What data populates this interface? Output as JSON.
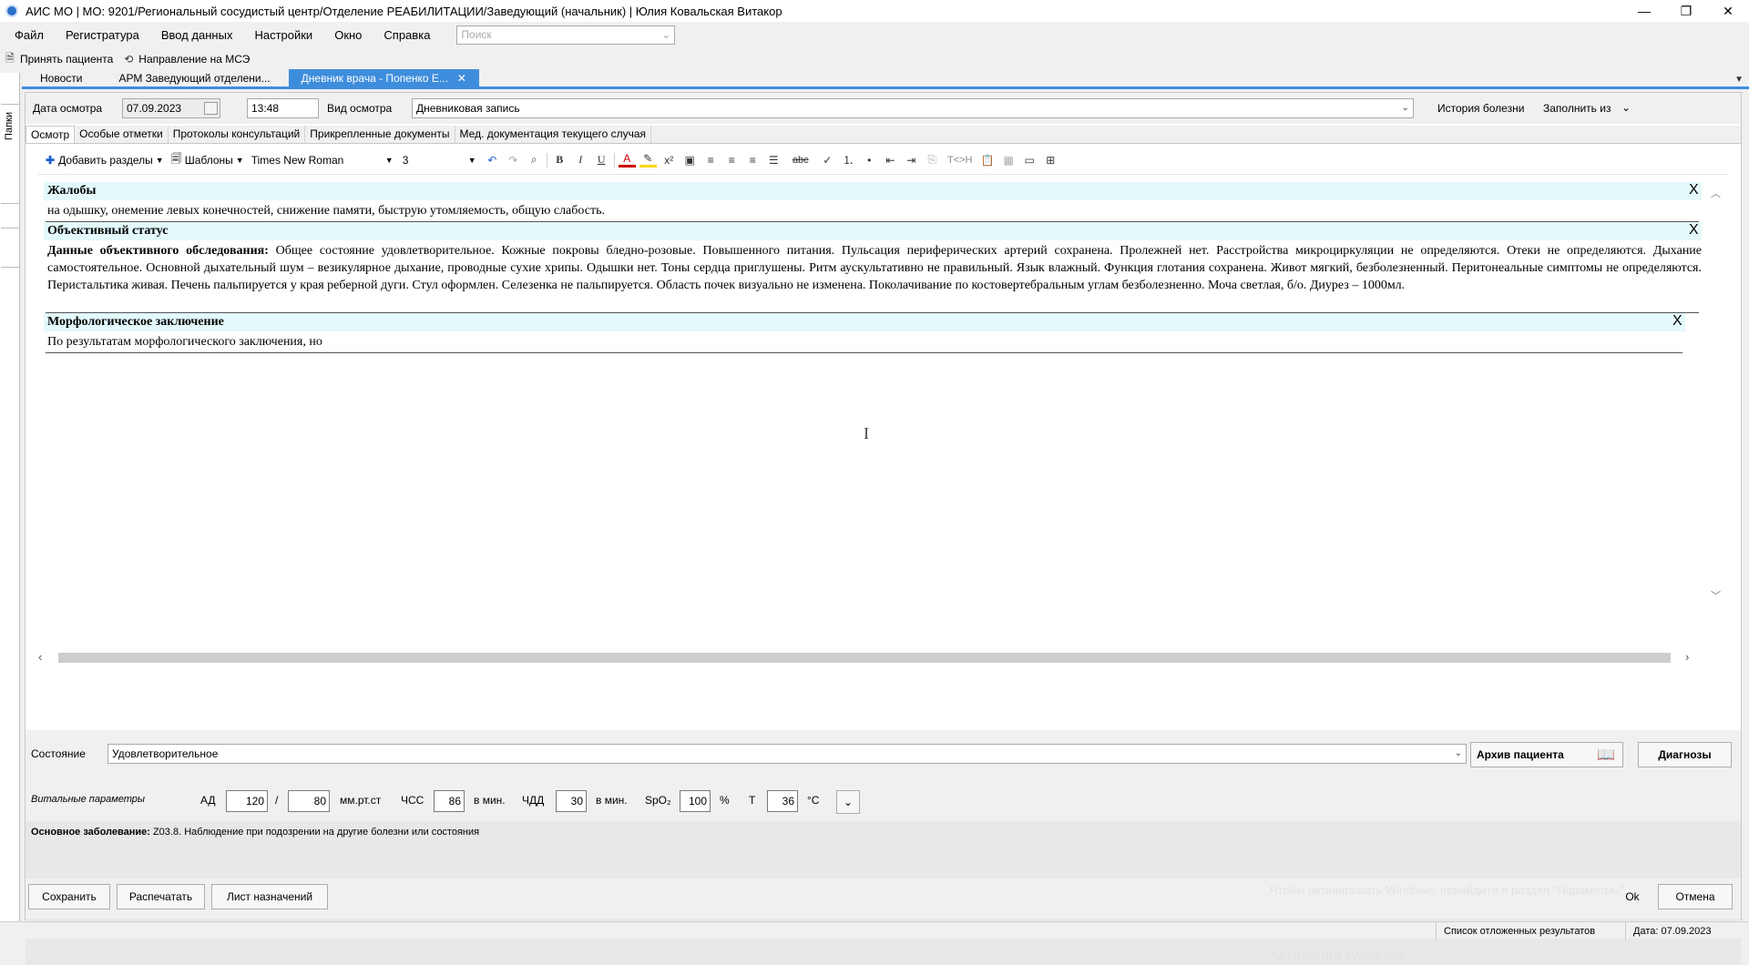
{
  "window": {
    "title": "АИС МО | МО: 9201/Региональный сосудистый центр/Отделение РЕАБИЛИТАЦИИ/Заведующий (начальник) | Юлия Ковальская Витакор",
    "minimize": "—",
    "restore": "❐",
    "close": "✕"
  },
  "menu": {
    "items": [
      "Файл",
      "Регистратура",
      "Ввод данных",
      "Настройки",
      "Окно",
      "Справка"
    ],
    "search_placeholder": "Поиск"
  },
  "quickbar": {
    "accept_patient": "Принять пациента",
    "mse_referral": "Направление на МСЭ"
  },
  "sidepanel": {
    "label": "Папки"
  },
  "tabs": [
    {
      "label": "Новости"
    },
    {
      "label": "АРМ Заведующий отделени..."
    },
    {
      "label": "Дневник врача - Попенко Е..."
    }
  ],
  "header": {
    "exam_date_label": "Дата осмотра",
    "exam_date": "07.09.2023",
    "exam_time": "13:48",
    "exam_type_label": "Вид осмотра",
    "exam_type": "Дневниковая запись",
    "history_label": "История болезни",
    "fill_from_label": "Заполнить из"
  },
  "subtabs": [
    "Осмотр",
    "Особые отметки",
    "Протоколы консультаций",
    "Прикрепленные документы",
    "Мед. документация текущего случая"
  ],
  "editor_toolbar": {
    "add_sections": "Добавить разделы",
    "templates": "Шаблоны",
    "font": "Times New Roman",
    "size": "3",
    "bold": "B",
    "italic": "I",
    "underline": "U",
    "tag_label": "T<>H"
  },
  "document": {
    "sections": [
      {
        "title": "Жалобы",
        "body": "на одышку, онемение левых конечностей, снижение памяти, быструю утомляемость, общую слабость."
      },
      {
        "title": "Объективный статус",
        "body_label": "Данные объективного обследования:",
        "body": " Общее состояние удовлетворительное. Кожные покровы бледно-розовые. Повышенного питания. Пульсация периферических артерий сохранена. Пролежней нет. Расстройства микроциркуляции не определяются. Отеки не определяются. Дыхание самостоятельное. Основной дыхательный шум – везикулярное дыхание, проводные сухие хрипы. Одышки нет. Тоны сердца приглушены. Ритм аускультативно не правильный. Язык влажный. Функция глотания сохранена. Живот мягкий, безболезненный. Перитонеальные симптомы не определяются. Перистальтика живая. Печень пальпируется у края реберной дуги. Стул оформлен. Селезенка не пальпируется. Область почек визуально не изменена. Поколачивание по костовертебральным углам безболезненно. Моча светлая, б/о. Диурез – 1000мл."
      },
      {
        "title": "Морфологическое заключение",
        "body": "По результатам морфологического заключения, но"
      }
    ],
    "close_mark": "X"
  },
  "state": {
    "label": "Состояние",
    "value": "Удовлетворительное",
    "archive_button": "Архив пациента",
    "diagnoses_button": "Диагнозы"
  },
  "vitals": {
    "label": "Витальные параметры",
    "bp_label": "АД",
    "bp_sys": "120",
    "bp_sep": "/",
    "bp_dia": "80",
    "bp_unit": "мм.рт.ст",
    "hr_label": "ЧСС",
    "hr": "86",
    "hr_unit": "в мин.",
    "rr_label": "ЧДД",
    "rr": "30",
    "rr_unit": "в мин.",
    "spo2_label": "SpO₂",
    "spo2": "100",
    "spo2_unit": "%",
    "temp_label": "Т",
    "temp": "36",
    "temp_unit": "°С"
  },
  "diagnosis": {
    "label": "Основное заболевание:",
    "value": " Z03.8. Наблюдение при подозрении на другие болезни или состояния"
  },
  "footer": {
    "save": "Сохранить",
    "print": "Распечатать",
    "prescriptions": "Лист назначений",
    "ok": "Ok",
    "cancel": "Отмена"
  },
  "watermark": {
    "line1": "Активация Windows",
    "line2": "Чтобы активировать Windows, перейдите в раздел \"Параметры\"."
  },
  "statusbar": {
    "pending": "Список отложенных результатов",
    "date": "Дата: 07.09.2023"
  }
}
